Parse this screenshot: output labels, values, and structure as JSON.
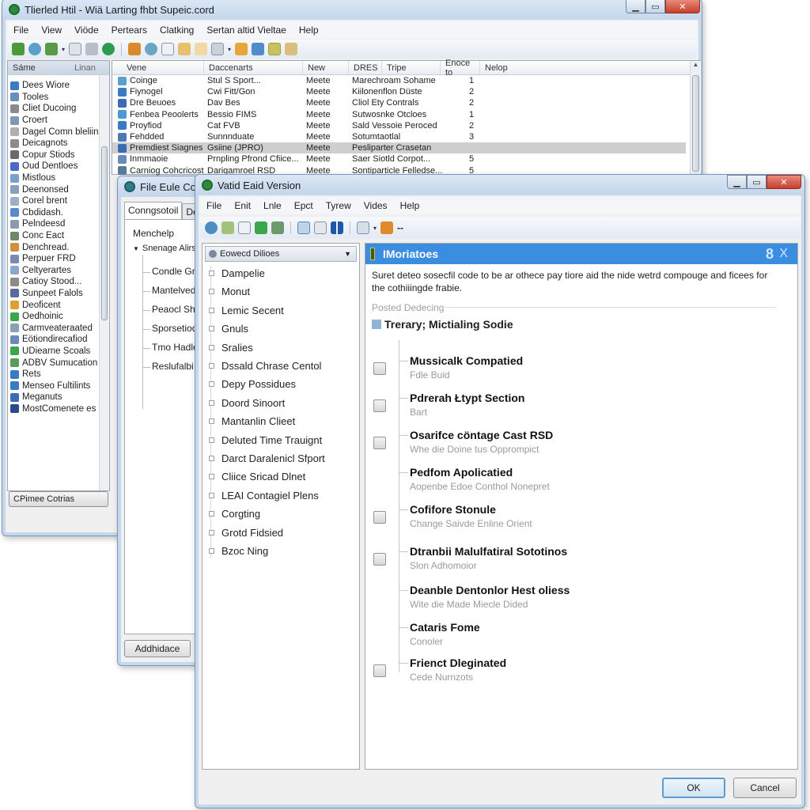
{
  "win1": {
    "title": "Tlierled Htil - Wiä Larting fhbt Supeic.cord",
    "menu": [
      "File",
      "View",
      "Viöde",
      "Pertears",
      "Clatking",
      "Sertan altid Vieltae",
      "Help"
    ],
    "left_header": [
      "Sáme",
      "Linan"
    ],
    "left_items": [
      "Dees Wiore",
      "Tooles",
      "Cliet Ducoing",
      "Croert",
      "Dagel Comn bleliing",
      "Deicagnots",
      "Copur Stiods",
      "Oud Dentloes",
      "Mistlous",
      "Deenonsed",
      "Corel brent",
      "Cbdidash.",
      "Pelndeesd",
      "Conc Eact",
      "Denchread.",
      "Perpuer FRD",
      "Celtyerartes",
      "Catioy Stood...",
      "Sunpeet Falols",
      "Deoficent",
      "Oedhoinic",
      "Carmveateraated",
      "Eötiondirecafiod",
      "UDiearne Scoals",
      "ADBV Sumucation",
      "Rets",
      "Menseo Fultilints",
      "Meganuts",
      "MostComenete es"
    ],
    "left_button": "CPimee Cotrias",
    "columns": [
      "Vene",
      "Daccenarts",
      "New",
      "DRES",
      "Tripe",
      "Enoce to",
      "Nelop"
    ],
    "rows": [
      {
        "name": "Coinge",
        "doc": "Stul S Sport...",
        "new": "Meete",
        "type": "Marechroam Sohame",
        "n": "1",
        "selected": false
      },
      {
        "name": "Fiynogel",
        "doc": "Cwi Fitt/Gon",
        "new": "Meete",
        "type": "Kiilonenflon Düste",
        "n": "2",
        "selected": false
      },
      {
        "name": "Dre Beuoes",
        "doc": "Dav Bes",
        "new": "Meete",
        "type": "Cliol Ety Contrals",
        "n": "2",
        "selected": false
      },
      {
        "name": "Fenbea Peoolerts",
        "doc": "Bessio FIMS",
        "new": "Meete",
        "type": "Sutwosnke Otcloes",
        "n": "1",
        "selected": false
      },
      {
        "name": "Proyfiod",
        "doc": "Cat FVB",
        "new": "Meete",
        "type": "Sald Vessoie Peroced",
        "n": "2",
        "selected": false
      },
      {
        "name": "Fehdded",
        "doc": "Sunnnduate",
        "new": "Meete",
        "type": "Sotumtaotlal",
        "n": "3",
        "selected": false
      },
      {
        "name": "Premdiest Siagnes",
        "doc": "Gsiine (JPRO)",
        "new": "Meete",
        "type": "Pesliparter Crasetan",
        "n": "",
        "selected": true
      },
      {
        "name": "Inmmaoie",
        "doc": "Prnpling Pfrond Cfiice...",
        "new": "Meete",
        "type": "Saer Siotld Corpot...",
        "n": "5",
        "selected": false
      },
      {
        "name": "Carniog Cohcricost",
        "doc": "Darigamroel RSD",
        "new": "Meete",
        "type": "Sontiparticle Felledse...",
        "n": "5",
        "selected": false
      }
    ]
  },
  "win2": {
    "title": "File Eule Comn",
    "tabs": [
      "Conngsotoil",
      "Deea"
    ],
    "tree_root": "Menchelp",
    "tree_group": "Snenage Alirs",
    "tree_children": [
      "Condle Grie",
      "Mantelved",
      "Peaocl Sha",
      "Sporsetiod",
      "Tmo Hadlo",
      "Reslufalbi"
    ],
    "button": "Addhidace"
  },
  "win3": {
    "title": "Vatid Eaid Version",
    "menu": [
      "File",
      "Enit",
      "Lnle",
      "Epct",
      "Tyrew",
      "Vides",
      "Help"
    ],
    "dropdown_value": "Eowecd Dilioes",
    "list_items": [
      "Dampelie",
      "Monut",
      "Lemic Secent",
      "Gnuls",
      "Sralies",
      "Dssald Chrase Centol",
      "Depy Possidues",
      "Doord Sinoort",
      "Mantanlin Clieet",
      "Deluted Time Trauignt",
      "Darct Daralenicl Sfport",
      "Cliice Sricad Dlnet",
      "LEAI Contagiel Plens",
      "Corgting",
      "Grotd Fidsied",
      "Bzoc Ning"
    ],
    "pane_title": "IMoriatoes",
    "pane_title_right": "8",
    "pane_close": "X",
    "description": "Suret deteo sosecfil code to be ar othece pay tiore aid the nide wetrd compouge and ficees for the cothiiingde frabie.",
    "section_label": "Posted Dedecing",
    "section_heading": "Trerary; Mictialing Sodie",
    "options": [
      {
        "title": "Mussicalk Compatied",
        "sub": "Fdle Buid",
        "checkbox": true
      },
      {
        "title": "Pdrerah Łtypt Section",
        "sub": "Bart",
        "checkbox": true
      },
      {
        "title": "Osarifce cöntage Cast RSD",
        "sub": "Whe die Doine tus Opprompict",
        "checkbox": true
      },
      {
        "title": "Pedfom Apolicatied",
        "sub": "Aopenbe Edoe Conthol Nonepret",
        "checkbox": false
      },
      {
        "title": "Cofifore Stonule",
        "sub": "Change Saivde Enline Orient",
        "checkbox": true
      },
      {
        "title": "Dtranbii Malulfatiral Sototinos",
        "sub": "Slon Adhomoior",
        "checkbox": true
      },
      {
        "title": "Deanble Dentonlor Hest oliess",
        "sub": "Wite die Made Miecle Dided",
        "checkbox": false
      },
      {
        "title": "Cataris Fome",
        "sub": "Conoler",
        "checkbox": false
      },
      {
        "title": "Frienct Dleginated",
        "sub": "Cede Nurnzots",
        "checkbox": true
      }
    ],
    "ok_label": "OK",
    "cancel_label": "Cancel"
  },
  "colors": {
    "accent_blue": "#3b8de0",
    "selection_gray": "#cfcfcf",
    "close_red": "#c6402c"
  }
}
